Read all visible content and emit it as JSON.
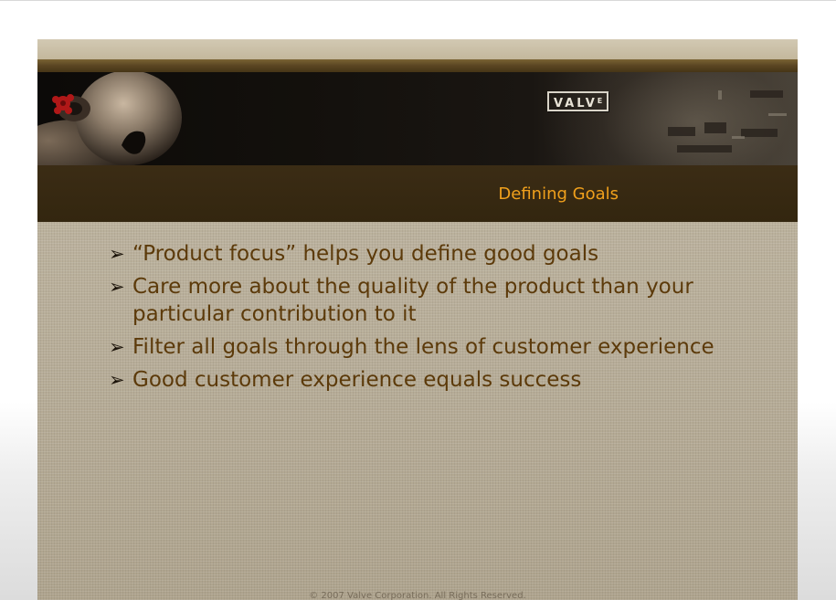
{
  "slide": {
    "logo_text": "VALV",
    "logo_superscript": "E",
    "title": "Defining  Goals",
    "bullets": [
      "“Product focus” helps you define good goals",
      "Care more about the quality of the product than your particular contribution to it",
      "Filter all goals through the lens of customer experience",
      "Good customer experience equals success"
    ],
    "bullet_glyph": "➢",
    "footer": "© 2007 Valve Corporation. All Rights Reserved."
  },
  "icons": {
    "bullet": "arrow-right-icon",
    "header_art": "bald-head-valve-art"
  },
  "colors": {
    "title": "#f0a01c",
    "bullet_text": "#5c3a0a",
    "title_band": "#3b2c15",
    "slide_background": "#bab19e"
  }
}
